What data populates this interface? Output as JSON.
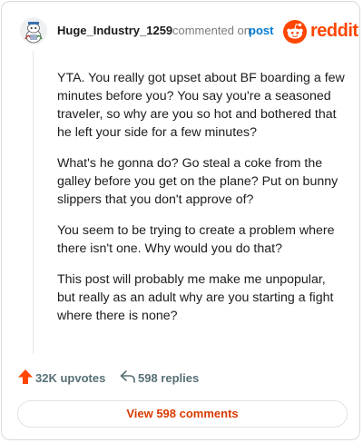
{
  "comment": {
    "username": "Huge_Industry_1259",
    "action": "commented on",
    "post_link": "post",
    "paragraphs": [
      "YTA. You really got upset about BF boarding a few minutes before you? You say you're a seasoned traveler, so why are you so hot and bothered that he left your side for a few minutes?",
      "What's he gonna do? Go steal a coke from the galley before you get on the plane? Put on bunny slippers that you don't approve of?",
      "You seem to be trying to create a problem where there isn't one. Why would you do that?",
      "This post will probably me make me unpopular, but really as an adult why are you starting a fight where there is none?"
    ]
  },
  "brand": {
    "name": "reddit",
    "color": "#ff4500"
  },
  "footer": {
    "upvotes": "32K upvotes",
    "replies": "598 replies",
    "view_button": "View 598 comments"
  },
  "icons": {
    "avatar": "snoo-avatar-icon",
    "upvote": "upvote-arrow-icon",
    "reply": "reply-arrow-icon",
    "logo": "reddit-logo-icon"
  }
}
